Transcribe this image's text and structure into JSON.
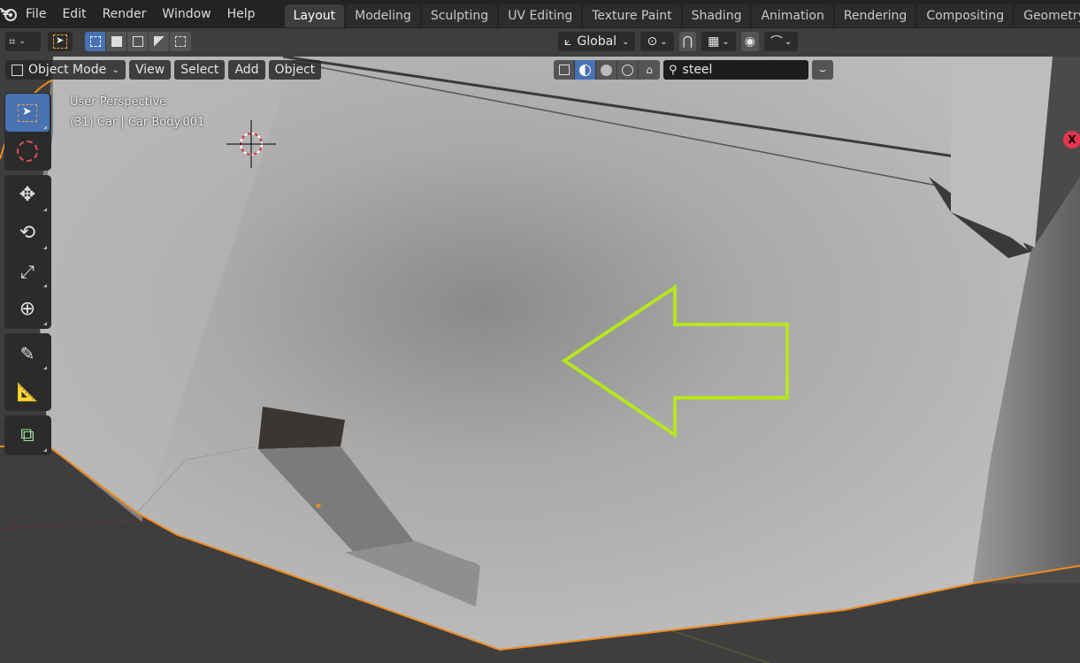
{
  "app": {
    "name": "Blender"
  },
  "menu": {
    "items": [
      "File",
      "Edit",
      "Render",
      "Window",
      "Help"
    ]
  },
  "workspaces": {
    "tabs": [
      "Layout",
      "Modeling",
      "Sculpting",
      "UV Editing",
      "Texture Paint",
      "Shading",
      "Animation",
      "Rendering",
      "Compositing",
      "Geometry Node"
    ],
    "active": "Layout"
  },
  "header": {
    "mode": "Object Mode",
    "view_menu": [
      "View",
      "Select",
      "Add",
      "Object"
    ],
    "transform_orientation": "Global",
    "search_value": "steel"
  },
  "viewport": {
    "perspective_label": "User Perspective",
    "object_info": "(31) Car | Car Body.001",
    "gizmo_axis_label": "X",
    "annotation_color": "#b5e61d",
    "selection_outline_color": "#f08c1e",
    "active_tool_color": "#4772b3"
  },
  "toolbar": {
    "tools": [
      "select-box",
      "cursor",
      "move",
      "rotate",
      "scale",
      "transform",
      "annotate",
      "measure",
      "add-cube"
    ],
    "active": "select-box"
  }
}
